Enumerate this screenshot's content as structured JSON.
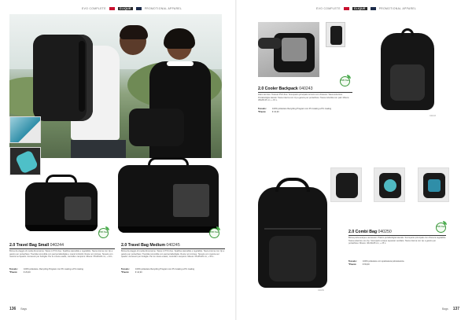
{
  "header": {
    "left": {
      "text1": "EVO COMPLETE",
      "chip": "CLIQUE",
      "text2": "PROMOTIONAL APPAREL"
    },
    "right": {
      "text1": "EVO COMPLETE",
      "chip": "CLIQUE",
      "text2": "PROMOTIONAL APPAREL"
    }
  },
  "products": [
    {
      "name": "2.0 Travel Bag Small",
      "code": "040244",
      "description": "Borsa da viaggio di media dimensione. Tasca in PVC-free. Spallina staccabile e regolabile. Tasca interna con zip a gancio per portachiavi. Tracolla removibile con pad portabottiglie e manici imbottiti. Ruote non incluse. Tessuto con manica sul quadro. Accessori per bottiglie: Per le misure esatte, controlla i campioni. Misure: 55x30x30 cm, + 23 L.",
      "material_label": "Tessuto:",
      "material_value": "100% poliestere, Recycling Program con PU coating a PU coating",
      "price_label": "*Prezzo:",
      "price_value": "€ 29,90",
      "badge": "PVC free"
    },
    {
      "name": "2.0 Travel Bag Medium",
      "code": "040245",
      "description": "Borsa da viaggio di media dimensione. Tasca in PVC-free. Spallina staccabile e regolabile. Tasca interna con zip a gancio per portachiavi. Tracolla removibile con pad portabottiglie. Ruote non incluse. Tessuto con manica sul quadro. Accessori per bottiglie: Per le misure esatte, controlla i campioni. Misure: 65x35x35 cm, + 55 L.",
      "material_label": "Tessuto:",
      "material_value": "100% poliestere Recycling Program con PU coating a PU coating",
      "price_label": "*Prezzo:",
      "price_value": "€ 44,90",
      "badge": "PVC free"
    },
    {
      "name": "2.0 Cooler Backpack",
      "code": "040243",
      "description": "Zaino termico. Tessuto PVC-free. Scomparto principale termico con chiusura. Tasca anteriore. Portabottiglie laterali. Tasca interna con zip a gancio per portachiavi. Tasca imbottita con pad. Misure: 38x28x15 cm, + 15 L.",
      "material_label": "Tessuto:",
      "material_value": "100% poliestere Recycling Program con PU coating a PU coating",
      "price_label": "*Prezzo:",
      "price_value": "€ 34,90",
      "badge": "PVC free"
    },
    {
      "name": "2.0 Combi Bag",
      "code": "040250",
      "description": "Borsa porta scarpe e accessori. Pratico portabottiglie laterale. Scomparto principale con chiusura regolabile. Tasca anteriore con zip. Scomparto scarpe separato ventilato. Tasca interna con zip a gancio per portachiavi. Misure: 40x30x25 cm, + 25 L.",
      "material_label": "Tessuto:",
      "material_value": "100% poliestere con spalmatura poliuretanica",
      "price_label": "*Prezzo:",
      "price_value": "€ 69,90",
      "badge": "PVC free"
    }
  ],
  "captions": {
    "backpack": "040243",
    "combi": "040250"
  },
  "footer": {
    "left": {
      "page": "136",
      "section": "Bags"
    },
    "right": {
      "section": "Bags",
      "page": "137"
    }
  },
  "colors": {
    "brand_red": "#c8102e",
    "brand_navy": "#1c2b4a",
    "eco_green": "#3c9a3c"
  }
}
